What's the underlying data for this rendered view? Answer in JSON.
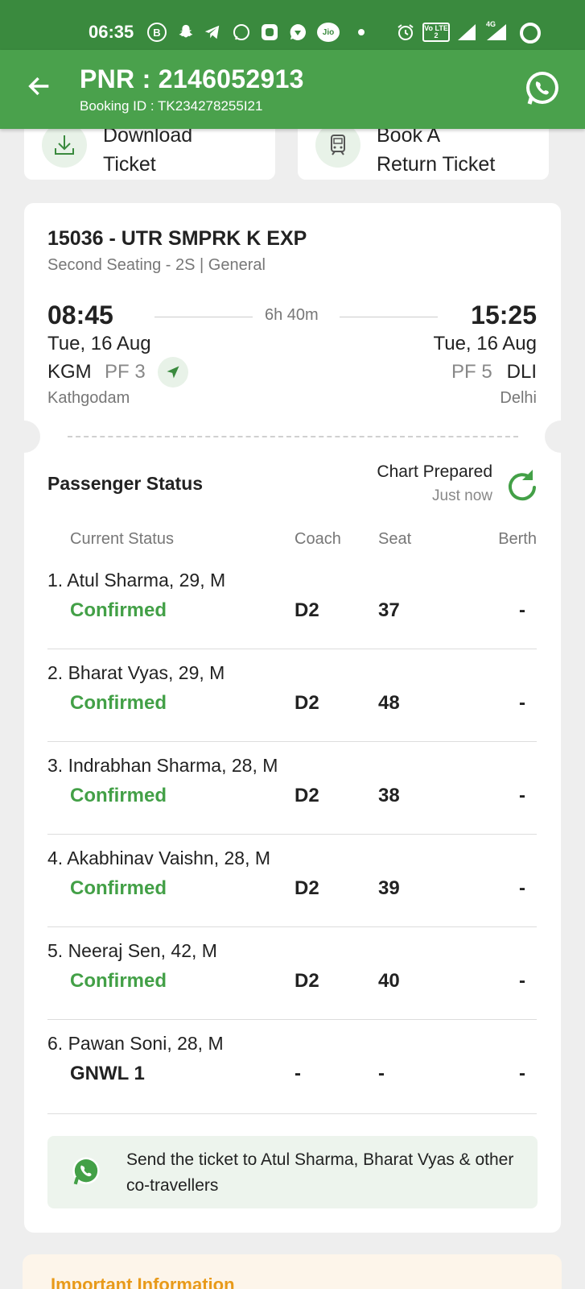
{
  "status_bar": {
    "time": "06:35",
    "icons": [
      "b-icon",
      "snapchat-icon",
      "telegram-icon",
      "whatsapp-icon",
      "app-icon",
      "chat-icon",
      "jio-icon",
      "dot-icon",
      "alarm-icon",
      "volte-icon",
      "signal-icon",
      "signal-4g-icon",
      "battery-icon"
    ],
    "lte_label": "Vo LTE 2",
    "net_label": "4G",
    "jio_label": "Jio"
  },
  "app_bar": {
    "pnr": "PNR : 2146052913",
    "booking_id": "Booking ID : TK234278255I21"
  },
  "actions": {
    "download_top": "Download",
    "download_bottom": "Ticket",
    "return_top": "Book A",
    "return_bottom": "Return Ticket"
  },
  "train": {
    "title": "15036 - UTR SMPRK K EXP",
    "class_info": "Second Seating - 2S |  General",
    "dep_time": "08:45",
    "arr_time": "15:25",
    "duration": "6h 40m",
    "dep_date": "Tue, 16 Aug",
    "arr_date": "Tue, 16 Aug",
    "dep_code": "KGM",
    "dep_pf": "PF 3",
    "arr_pf": "PF 5",
    "arr_code": "DLI",
    "dep_city": "Kathgodam",
    "arr_city": "Delhi"
  },
  "passenger_status": {
    "title": "Passenger Status",
    "chart_status": "Chart Prepared",
    "updated": "Just now",
    "headers": {
      "status": "Current Status",
      "coach": "Coach",
      "seat": "Seat",
      "berth": "Berth"
    },
    "passengers": [
      {
        "name": "1. Atul Sharma, 29, M",
        "status": "Confirmed",
        "coach": "D2",
        "seat": "37",
        "berth": "-"
      },
      {
        "name": "2. Bharat Vyas, 29, M",
        "status": "Confirmed",
        "coach": "D2",
        "seat": "48",
        "berth": "-"
      },
      {
        "name": "3. Indrabhan Sharma, 28, M",
        "status": "Confirmed",
        "coach": "D2",
        "seat": "38",
        "berth": "-"
      },
      {
        "name": "4. Akabhinav Vaishn, 28, M",
        "status": "Confirmed",
        "coach": "D2",
        "seat": "39",
        "berth": "-"
      },
      {
        "name": "5. Neeraj Sen, 42, M",
        "status": "Confirmed",
        "coach": "D2",
        "seat": "40",
        "berth": "-"
      },
      {
        "name": "6. Pawan Soni, 28, M",
        "status": "GNWL  1",
        "coach": "-",
        "seat": "-",
        "berth": "-"
      }
    ]
  },
  "share": {
    "text": "Send the ticket to Atul Sharma, Bharat Vyas & other co-travellers"
  },
  "info": {
    "title": "Important Information"
  },
  "colors": {
    "status_bar": "#3a8a3e",
    "app_bar": "#4aa14c",
    "confirmed": "#43a047",
    "waitlist": "#222222",
    "info_title": "#e89a1a"
  }
}
